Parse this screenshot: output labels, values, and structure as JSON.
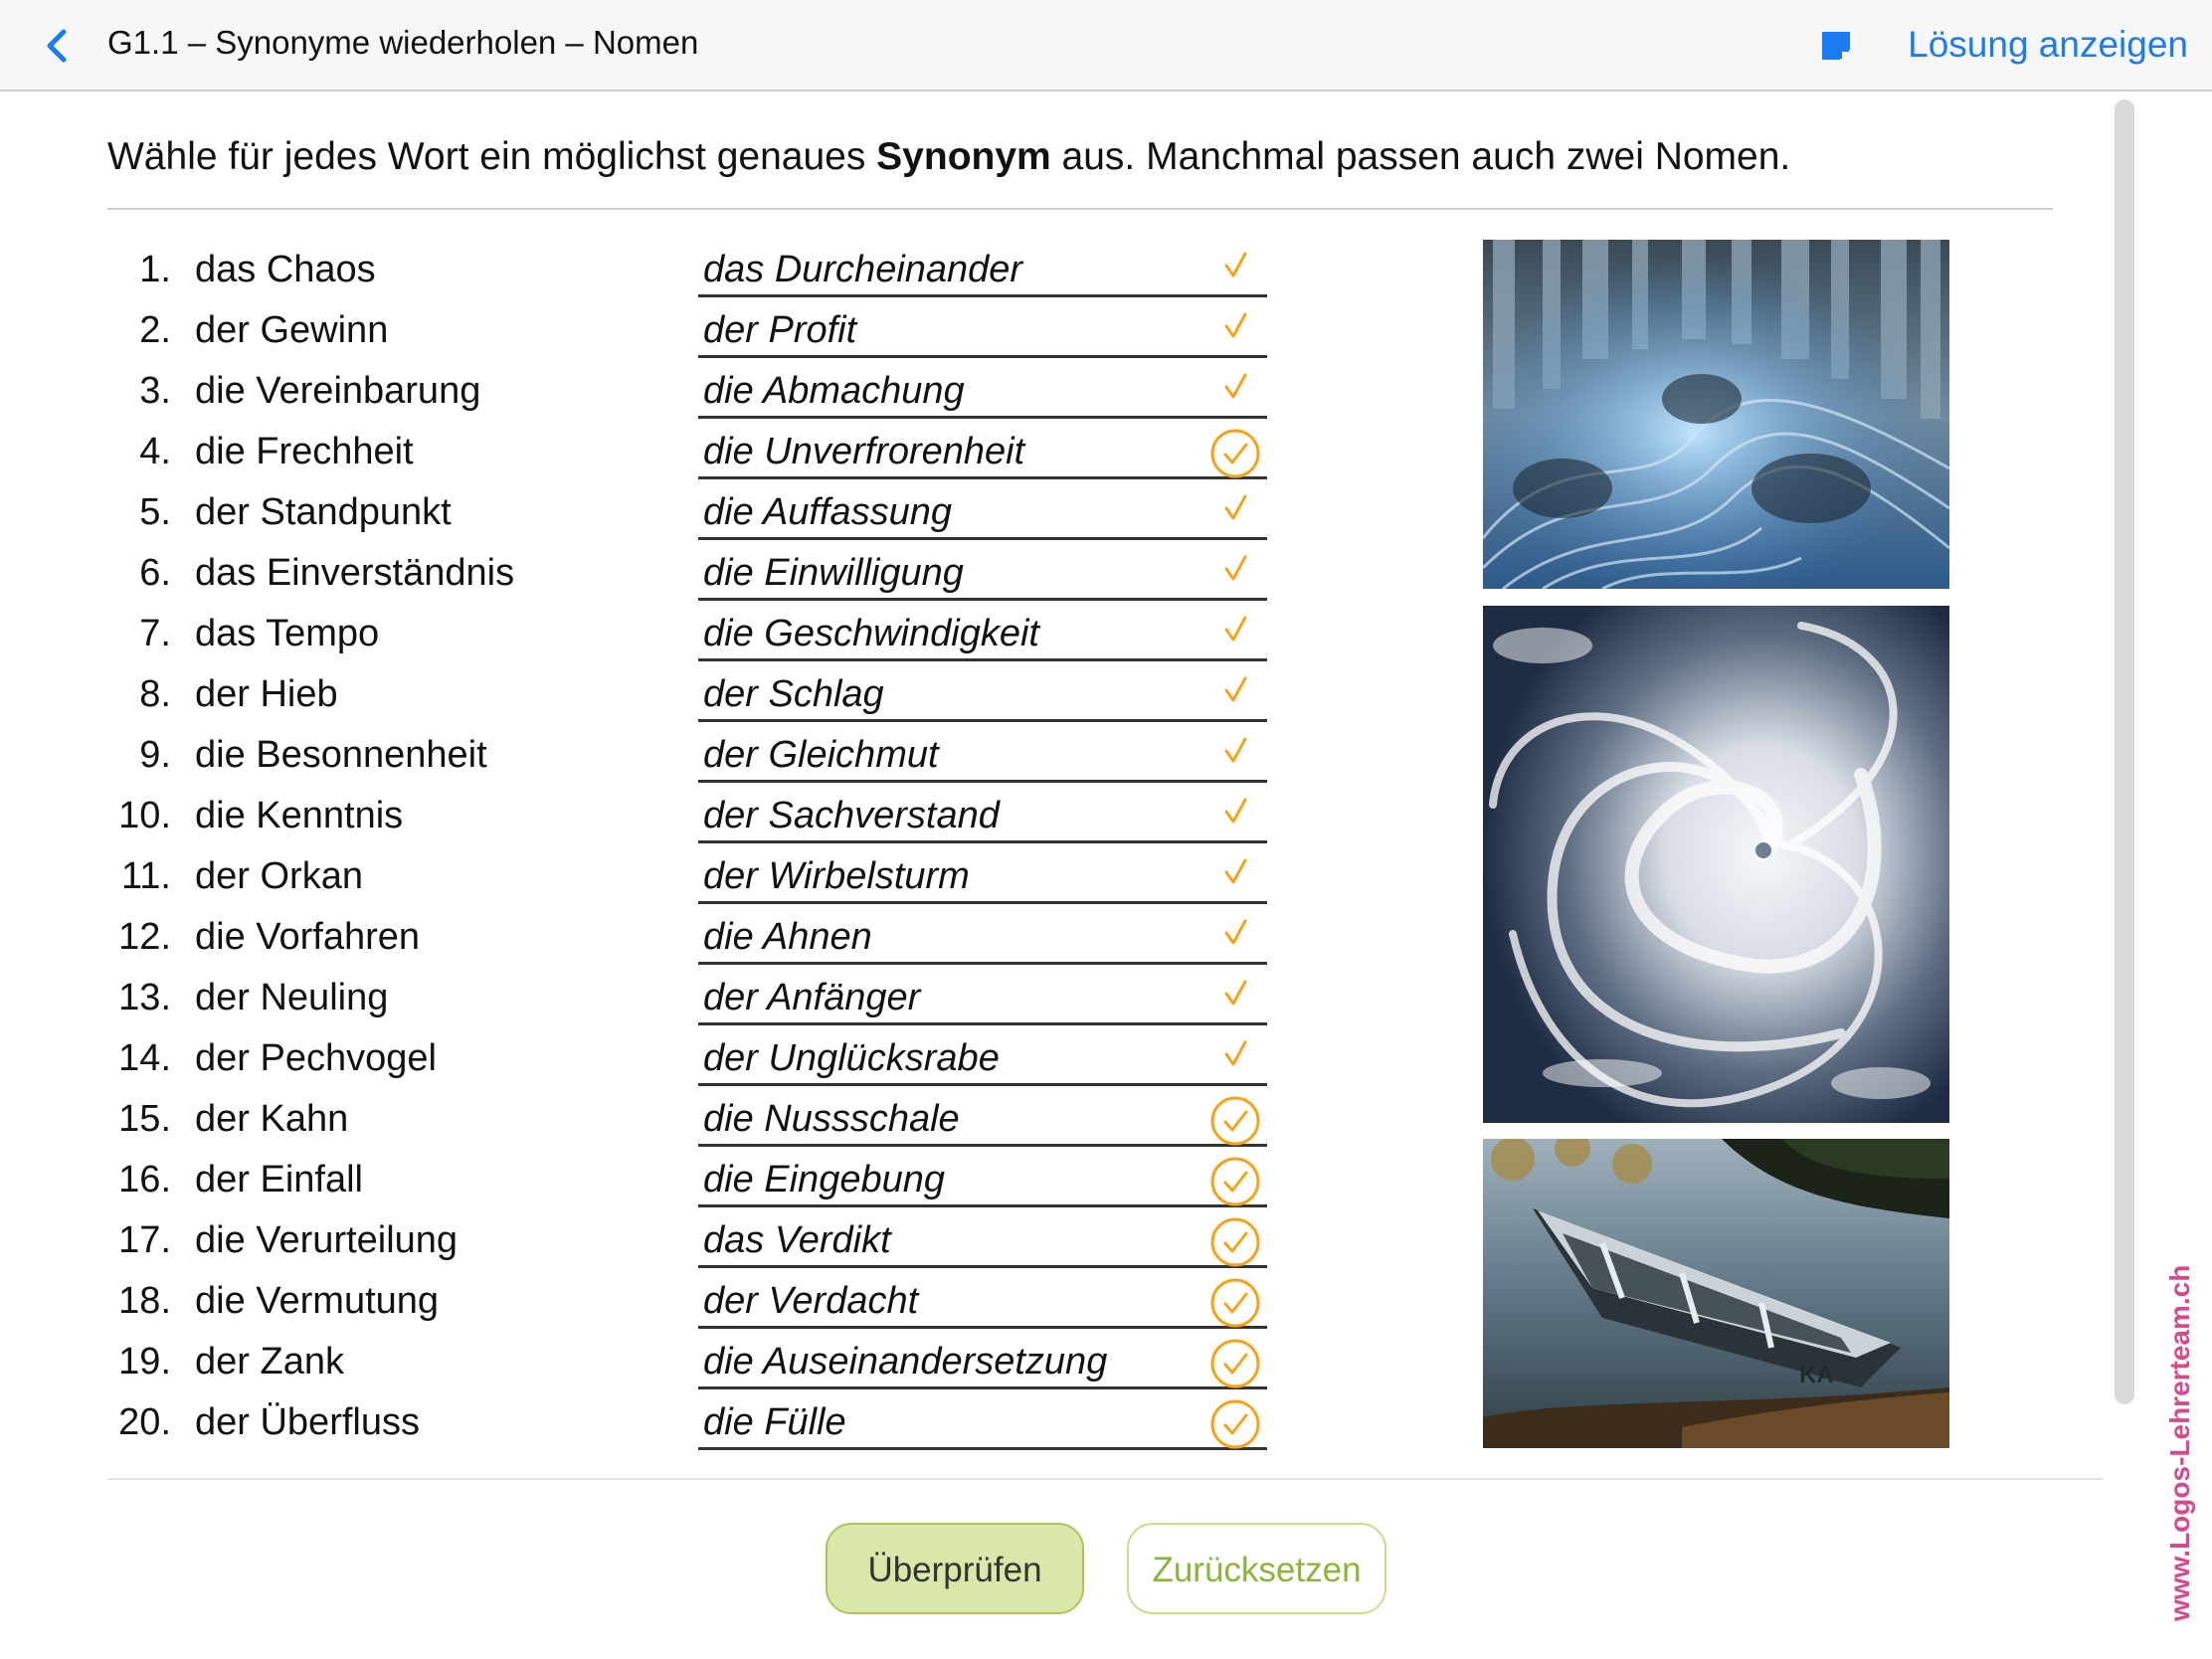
{
  "navbar": {
    "title": "G1.1 – Synonyme wiederholen – Nomen",
    "solution_label": "Lösung anzeigen",
    "icons": [
      "back-chevron-icon",
      "notes-icon"
    ]
  },
  "instruction": {
    "pre": "Wähle für jedes Wort ein möglichst genaues ",
    "bold": "Synonym",
    "post": " aus. Manchmal passen auch zwei Nomen."
  },
  "items": [
    {
      "num": "1.",
      "word": "das Chaos",
      "answer": "das Durcheinander",
      "check": "plain"
    },
    {
      "num": "2.",
      "word": "der Gewinn",
      "answer": "der Profit",
      "check": "plain"
    },
    {
      "num": "3.",
      "word": "die Vereinbarung",
      "answer": "die Abmachung",
      "check": "plain"
    },
    {
      "num": "4.",
      "word": "die Frechheit",
      "answer": "die Unverfrorenheit",
      "check": "circled"
    },
    {
      "num": "5.",
      "word": "der Standpunkt",
      "answer": "die Auffassung",
      "check": "plain"
    },
    {
      "num": "6.",
      "word": "das Einverständnis",
      "answer": "die Einwilligung",
      "check": "plain"
    },
    {
      "num": "7.",
      "word": "das Tempo",
      "answer": "die Geschwindigkeit",
      "check": "plain"
    },
    {
      "num": "8.",
      "word": "der Hieb",
      "answer": "der Schlag",
      "check": "plain"
    },
    {
      "num": "9.",
      "word": "die Besonnenheit",
      "answer": "der Gleichmut",
      "check": "plain"
    },
    {
      "num": "10.",
      "word": "die Kenntnis",
      "answer": "der Sachverstand",
      "check": "plain"
    },
    {
      "num": "11.",
      "word": "der Orkan",
      "answer": "der Wirbelsturm",
      "check": "plain"
    },
    {
      "num": "12.",
      "word": "die Vorfahren",
      "answer": "die Ahnen",
      "check": "plain"
    },
    {
      "num": "13.",
      "word": "der Neuling",
      "answer": "der Anfänger",
      "check": "plain"
    },
    {
      "num": "14.",
      "word": "der Pechvogel",
      "answer": "der Unglücksrabe",
      "check": "plain"
    },
    {
      "num": "15.",
      "word": "der Kahn",
      "answer": "die Nussschale",
      "check": "circled"
    },
    {
      "num": "16.",
      "word": "der Einfall",
      "answer": "die Eingebung",
      "check": "circled"
    },
    {
      "num": "17.",
      "word": "die Verurteilung",
      "answer": "das Verdikt",
      "check": "circled"
    },
    {
      "num": "18.",
      "word": "die Vermutung",
      "answer": "der Verdacht",
      "check": "circled"
    },
    {
      "num": "19.",
      "word": "der Zank",
      "answer": "die Auseinandersetzung",
      "check": "circled"
    },
    {
      "num": "20.",
      "word": "der Überfluss",
      "answer": "die Fülle",
      "check": "circled"
    }
  ],
  "images": [
    "fractal-image",
    "hurricane-image",
    "boat-image"
  ],
  "buttons": {
    "check_label": "Überprüfen",
    "reset_label": "Zurücksetzen"
  },
  "watermark": "www.Logos-Lehrerteam.ch",
  "colors": {
    "accent": "#1a7cf0",
    "check": "#f2a51a",
    "button_green": "#d9e8a9",
    "button_green_text": "#8ab53a",
    "watermark": "#d44a8c"
  }
}
